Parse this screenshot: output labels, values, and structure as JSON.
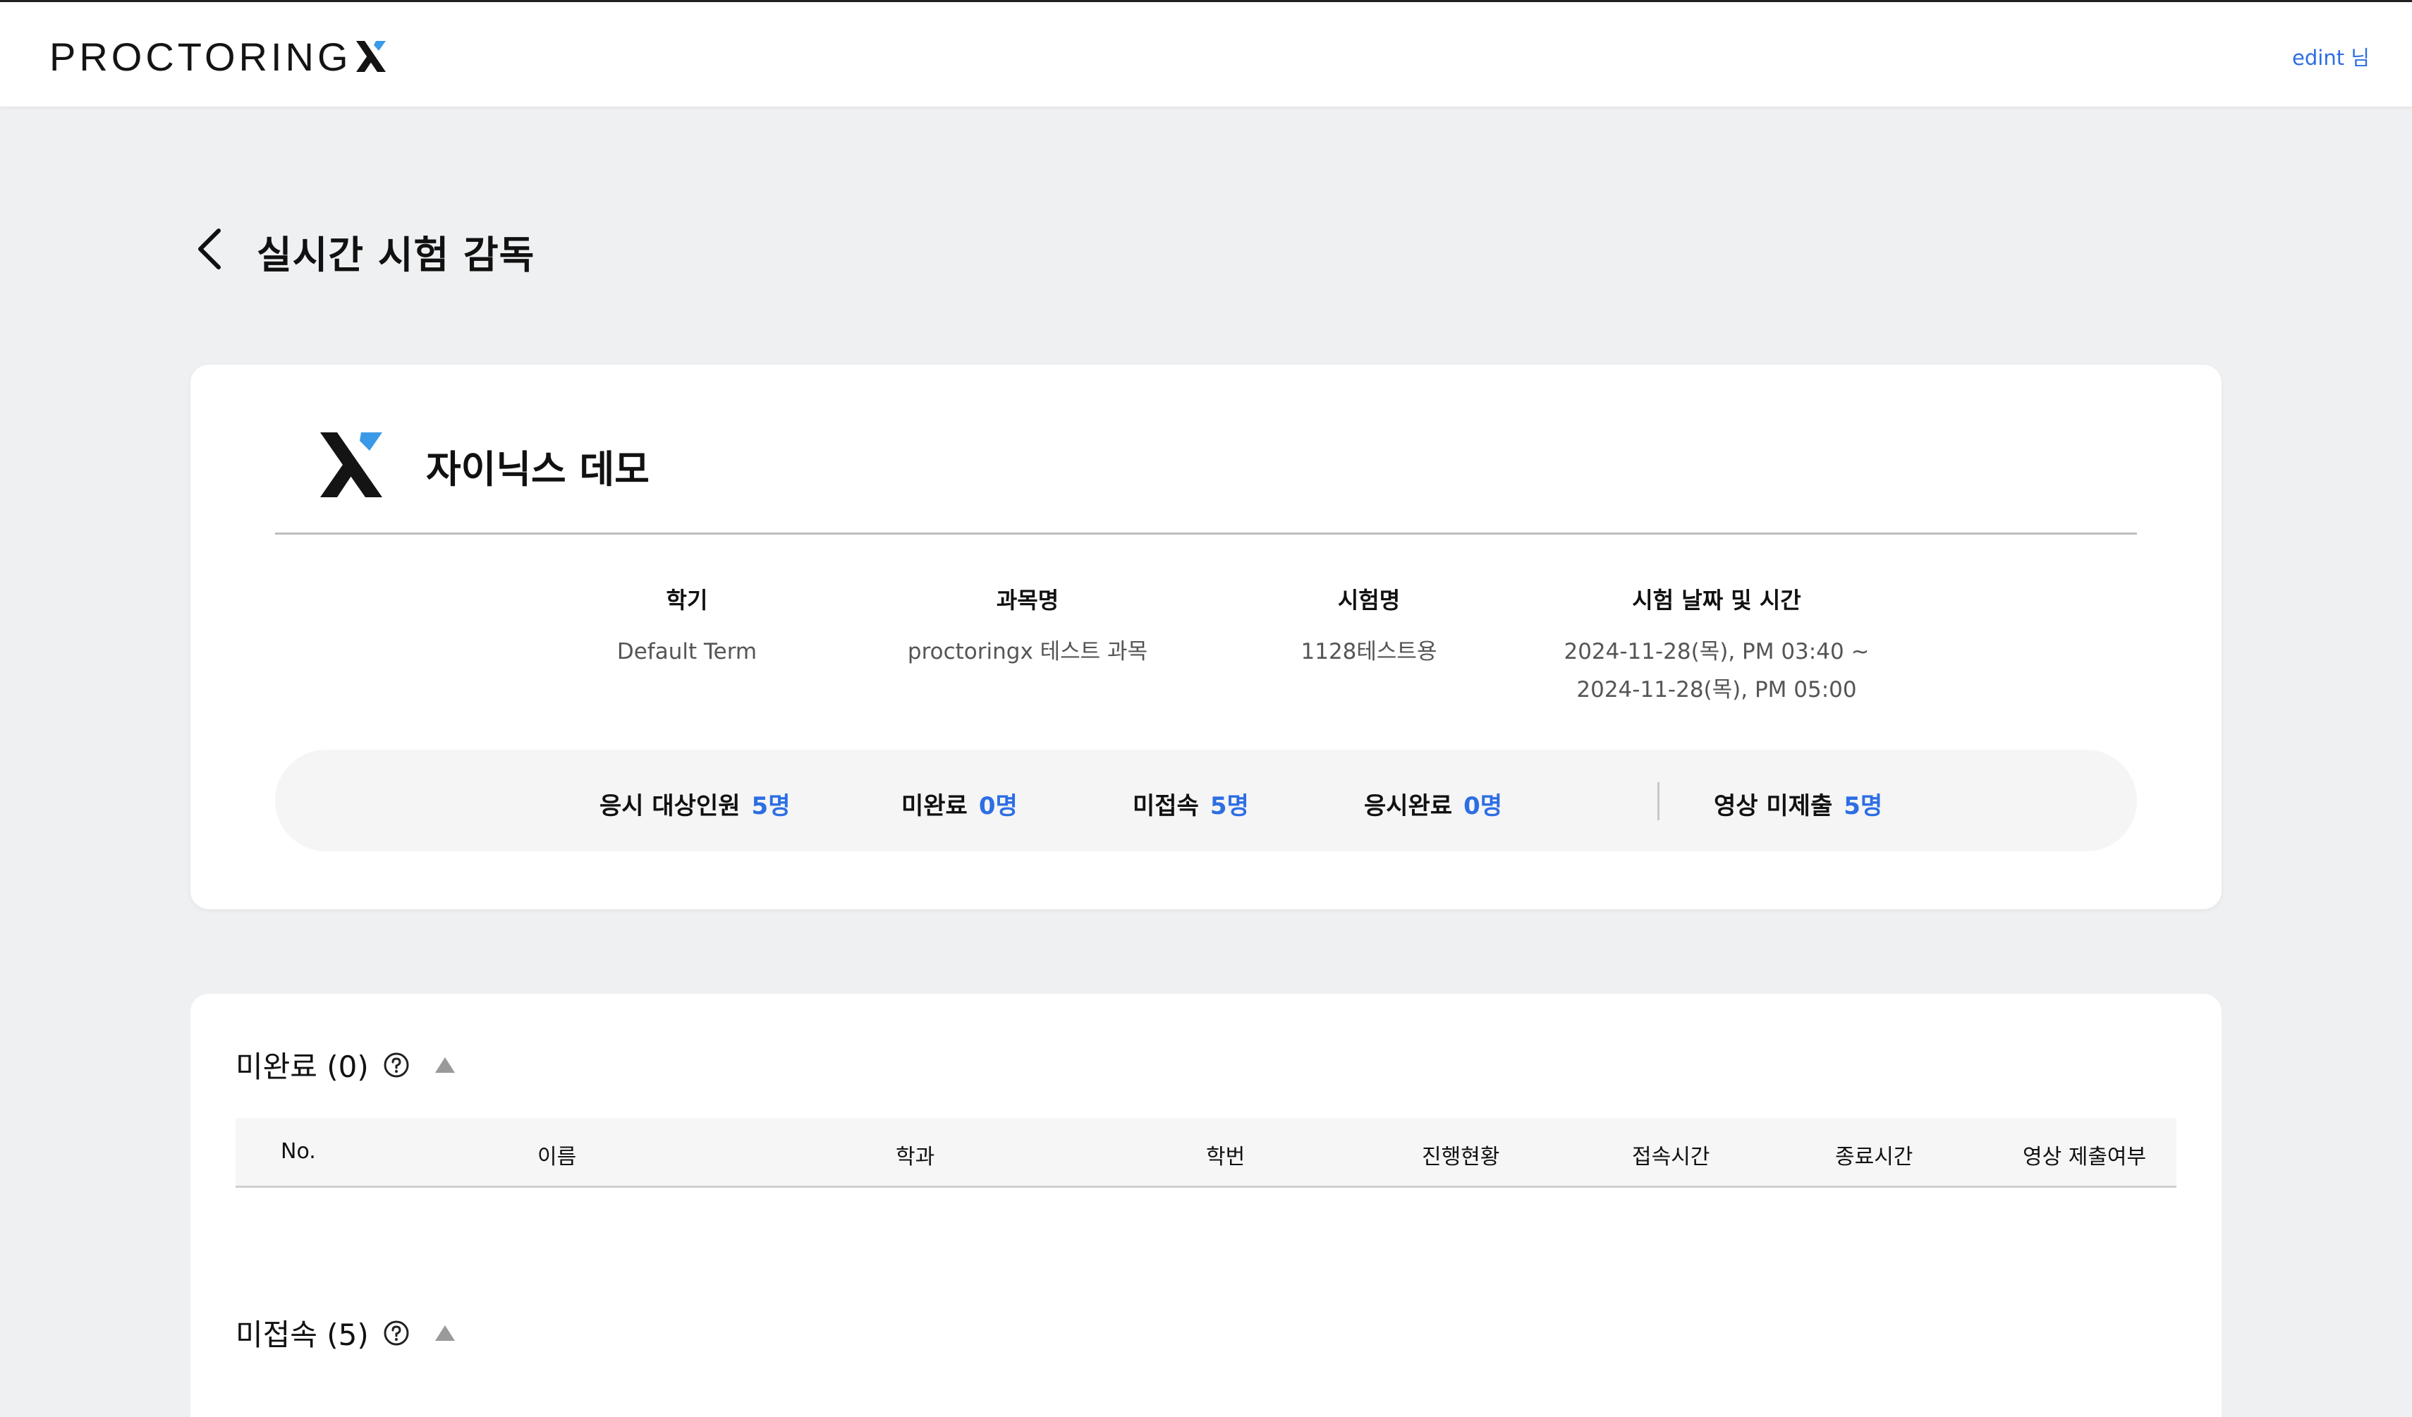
{
  "header": {
    "brand": "PROCTORING",
    "user_link": "edint 님"
  },
  "page": {
    "title": "실시간 시험 감독"
  },
  "exam_info": {
    "org_name": "자이닉스 데모",
    "fields": {
      "term": {
        "label": "학기",
        "value": "Default Term"
      },
      "course": {
        "label": "과목명",
        "value": "proctoringx 테스트 과목"
      },
      "exam": {
        "label": "시험명",
        "value": "1128테스트용"
      },
      "datetime": {
        "label": "시험 날짜 및 시간",
        "value_start": "2024-11-28(목), PM 03:40 ~",
        "value_end": "2024-11-28(목), PM 05:00"
      }
    },
    "stats": {
      "target": {
        "label": "응시 대상인원",
        "value": "5명"
      },
      "incomplete": {
        "label": "미완료",
        "value": "0명"
      },
      "not_connected": {
        "label": "미접속",
        "value": "5명"
      },
      "completed": {
        "label": "응시완료",
        "value": "0명"
      },
      "video_not_submitted": {
        "label": "영상 미제출",
        "value": "5명"
      }
    }
  },
  "sections": {
    "incomplete": {
      "title": "미완료 (0)"
    },
    "not_connected": {
      "title": "미접속 (5)"
    }
  },
  "table": {
    "columns": [
      "No.",
      "이름",
      "학과",
      "학번",
      "진행현황",
      "접속시간",
      "종료시간",
      "영상 제출여부"
    ]
  },
  "colors": {
    "accent": "#2d6ee3",
    "logo_accent": "#3b9ae8",
    "background": "#eff0f2"
  }
}
